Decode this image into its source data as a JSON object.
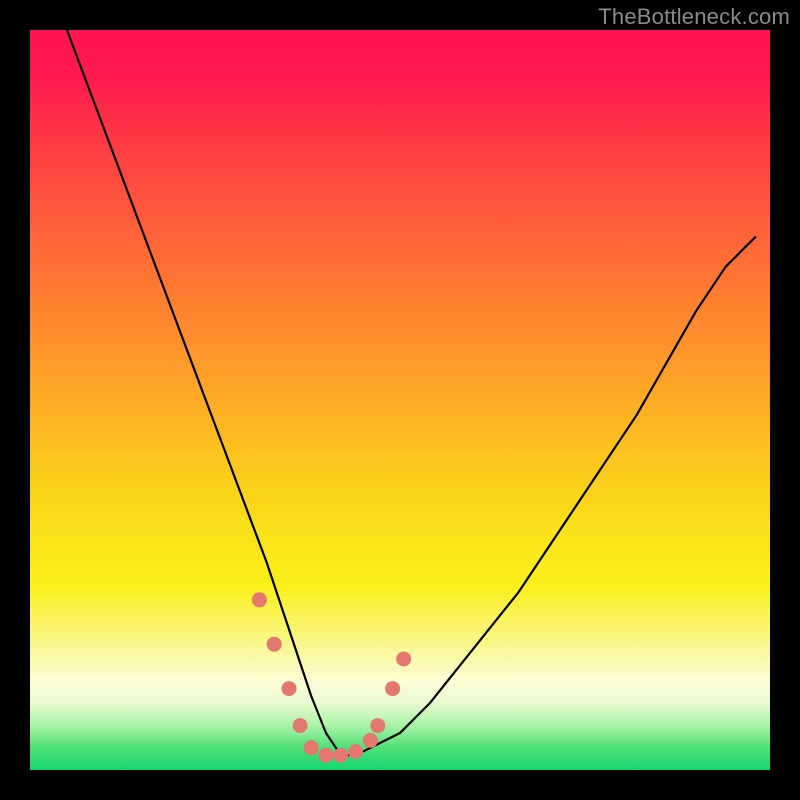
{
  "watermark": "TheBottleneck.com",
  "chart_data": {
    "type": "line",
    "title": "",
    "xlabel": "",
    "ylabel": "",
    "xlim": [
      0,
      100
    ],
    "ylim": [
      0,
      100
    ],
    "series": [
      {
        "name": "bottleneck-curve",
        "x": [
          5,
          8,
          11,
          14,
          17,
          20,
          23,
          26,
          29,
          32,
          34,
          36,
          38,
          40,
          42,
          44,
          46,
          50,
          54,
          58,
          62,
          66,
          70,
          74,
          78,
          82,
          86,
          90,
          94,
          98
        ],
        "y": [
          100,
          92,
          84,
          76,
          68,
          60,
          52,
          44,
          36,
          28,
          22,
          16,
          10,
          5,
          2,
          2,
          3,
          5,
          9,
          14,
          19,
          24,
          30,
          36,
          42,
          48,
          55,
          62,
          68,
          72
        ]
      }
    ],
    "markers": {
      "name": "optimum-band-dots",
      "color": "#e4786f",
      "points": [
        {
          "x": 31,
          "y": 23
        },
        {
          "x": 33,
          "y": 17
        },
        {
          "x": 35,
          "y": 11
        },
        {
          "x": 36.5,
          "y": 6
        },
        {
          "x": 38,
          "y": 3
        },
        {
          "x": 40,
          "y": 2
        },
        {
          "x": 42,
          "y": 2
        },
        {
          "x": 44,
          "y": 2.5
        },
        {
          "x": 46,
          "y": 4
        },
        {
          "x": 47,
          "y": 6
        },
        {
          "x": 49,
          "y": 11
        },
        {
          "x": 50.5,
          "y": 15
        }
      ]
    },
    "gradient_stops": [
      {
        "pos": 0,
        "color": "#ff1552"
      },
      {
        "pos": 30,
        "color": "#ff6a36"
      },
      {
        "pos": 58,
        "color": "#fbc61e"
      },
      {
        "pos": 82,
        "color": "#f9f680"
      },
      {
        "pos": 100,
        "color": "#14d66e"
      }
    ]
  }
}
